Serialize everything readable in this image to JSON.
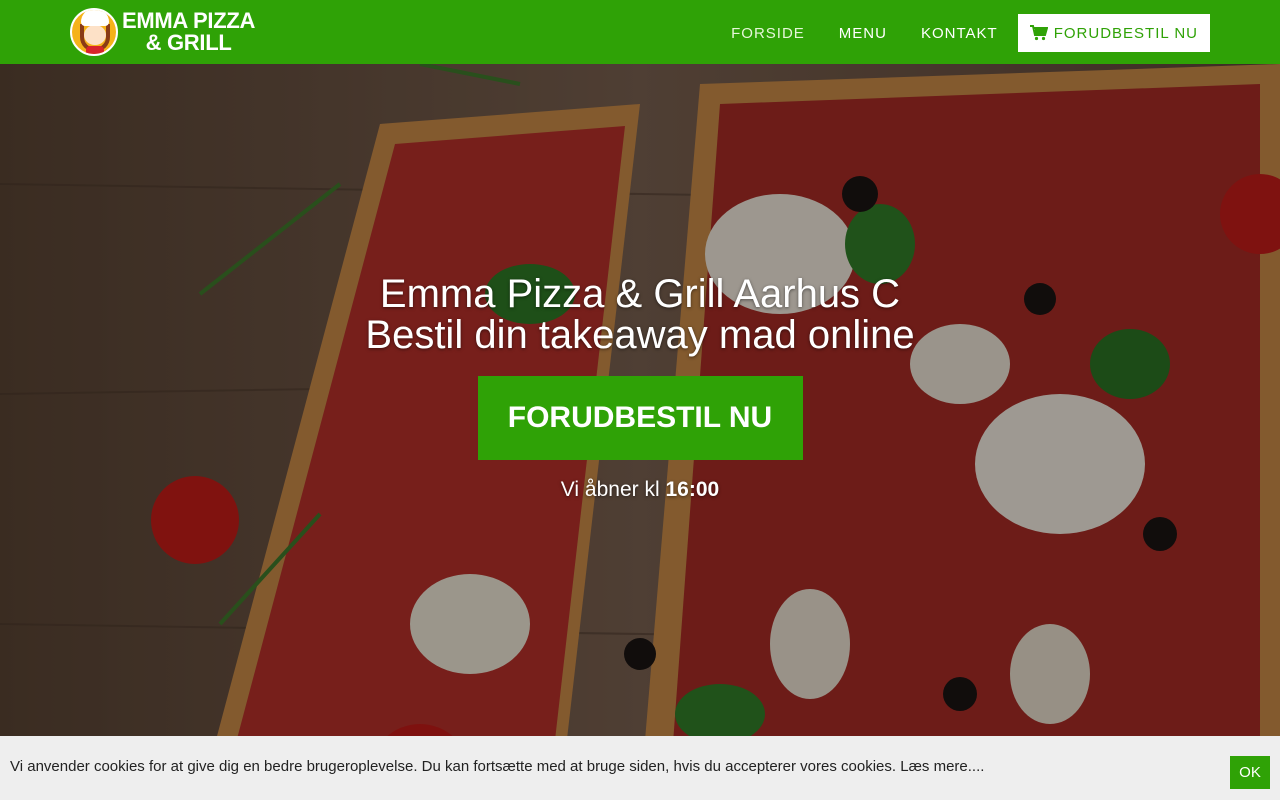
{
  "brand": {
    "name_line1": "EMMA PIZZA",
    "name_line2": "& GRILL",
    "primary_color": "#2fa206"
  },
  "nav": {
    "items": [
      {
        "label": "FORSIDE",
        "active": true
      },
      {
        "label": "MENU",
        "active": false
      },
      {
        "label": "KONTAKT",
        "active": false
      }
    ],
    "order_button": {
      "label": "FORUDBESTIL NU",
      "icon": "shopping-cart-icon"
    }
  },
  "hero": {
    "title_line1": "Emma Pizza & Grill Aarhus C",
    "title_line2": "Bestil din takeaway mad online",
    "cta_label": "FORUDBESTIL NU",
    "opening_prefix": "Vi åbner kl",
    "opening_time": "16:00"
  },
  "cookie_bar": {
    "text": "Vi anvender cookies for at give dig en bedre brugeroplevelse. Du kan fortsætte med at bruge siden, hvis du accepterer vores cookies. Læs mere....",
    "ok_label": "OK"
  }
}
